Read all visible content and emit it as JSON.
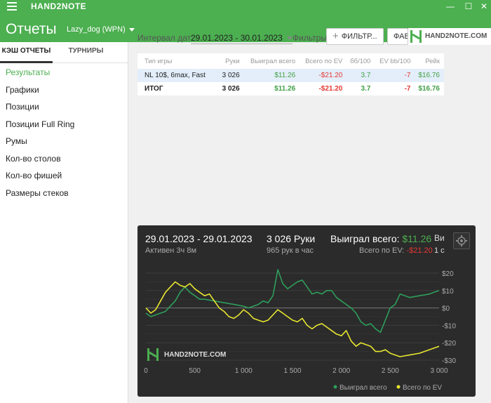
{
  "window": {
    "app_name": "HAND2NOTE",
    "minimize": "—",
    "maximize": "☐",
    "close": "✕"
  },
  "header": {
    "title": "Отчеты",
    "account": "Lazy_dog (WPN)"
  },
  "sidebar": {
    "tabs": [
      {
        "label": "КЭШ ОТЧЕТЫ"
      },
      {
        "label": "ТУРНИРЫ"
      }
    ],
    "items": [
      {
        "label": "Результаты"
      },
      {
        "label": "Графики"
      },
      {
        "label": "Позиции"
      },
      {
        "label": "Позиции Full Ring"
      },
      {
        "label": "Румы"
      },
      {
        "label": "Кол-во столов"
      },
      {
        "label": "Кол-во фишей"
      },
      {
        "label": "Размеры стеков"
      }
    ]
  },
  "filterbar": {
    "interval_label": "Интервал дат:",
    "date_range": "29.01.2023 - 30.01.2023",
    "filters_label": "Фильтры:",
    "filters_button": "ФИЛЬТР...",
    "fav_button": "ФАВ",
    "brand": "HAND2NOTE.COM"
  },
  "table": {
    "headers": [
      "Тип игры",
      "Руки",
      "Выиграл всего",
      "Всего по EV",
      "бб/100",
      "EV bb/100",
      "Рейк"
    ],
    "rows": [
      {
        "game": "NL 10$, 6max, Fast",
        "hands": "3 026",
        "won": "$11.26",
        "ev": "-$21.20",
        "bb100": "3.7",
        "evbb": "-7",
        "rake": "$16.76"
      }
    ],
    "total": {
      "game": "ИТОГ",
      "hands": "3 026",
      "won": "$11.26",
      "ev": "-$21.20",
      "bb100": "3.7",
      "evbb": "-7",
      "rake": "$16.76"
    }
  },
  "chart_panel": {
    "range": "29.01.2023 - 29.01.2023",
    "active": "Активен 3ч 8м",
    "hands": "3 026 Руки",
    "rate": "965 рук в час",
    "won_label": "Выиграл всего:",
    "won_value": "$11.26",
    "ev_label": "Всего по EV:",
    "ev_value": "-$21.20",
    "extra_top": "Ви",
    "extra_bottom": "1 с",
    "watermark": "HAND2NOTE.COM"
  },
  "chart_data": {
    "type": "line",
    "xlim": [
      0,
      3000
    ],
    "ylim": [
      -30,
      20
    ],
    "x_ticks": [
      "0",
      "500",
      "1 000",
      "1 500",
      "2 000",
      "2 500",
      "3 000"
    ],
    "y_ticks": [
      "$20",
      "$10",
      "$0",
      "-$10",
      "-$20",
      "-$30"
    ],
    "grid": true,
    "legend": "bottom-right",
    "colors": {
      "won": "#2e9e5b",
      "ev": "#e8e630"
    },
    "series": [
      {
        "name": "Выиграл всего",
        "color": "#2e9e5b",
        "x": [
          0,
          50,
          100,
          150,
          200,
          250,
          300,
          350,
          400,
          450,
          500,
          550,
          600,
          700,
          800,
          900,
          1000,
          1050,
          1100,
          1150,
          1200,
          1250,
          1300,
          1350,
          1400,
          1450,
          1500,
          1550,
          1600,
          1650,
          1700,
          1750,
          1800,
          1850,
          1900,
          1950,
          2000,
          2050,
          2100,
          2150,
          2200,
          2250,
          2300,
          2350,
          2400,
          2450,
          2500,
          2550,
          2600,
          2700,
          2800,
          2900,
          3000
        ],
        "y": [
          -3,
          -5,
          -4,
          -3,
          -2,
          1,
          4,
          9,
          12,
          9,
          7,
          5,
          5,
          4,
          3,
          2,
          1,
          0,
          1,
          2,
          4,
          3,
          7,
          22,
          14,
          11,
          13,
          15,
          16,
          12,
          8,
          9,
          8,
          10,
          10,
          6,
          4,
          2,
          0,
          -3,
          -8,
          -10,
          -9,
          -12,
          -14,
          -7,
          0,
          2,
          8,
          6,
          7,
          8,
          10
        ]
      },
      {
        "name": "Всего по EV",
        "color": "#e8e630",
        "x": [
          0,
          50,
          100,
          150,
          200,
          250,
          300,
          350,
          400,
          450,
          500,
          550,
          600,
          650,
          700,
          750,
          800,
          850,
          900,
          950,
          1000,
          1050,
          1100,
          1150,
          1200,
          1250,
          1300,
          1350,
          1400,
          1450,
          1500,
          1550,
          1600,
          1650,
          1700,
          1750,
          1800,
          1850,
          1900,
          1950,
          2000,
          2050,
          2100,
          2150,
          2200,
          2250,
          2300,
          2350,
          2400,
          2450,
          2500,
          2550,
          2600,
          2700,
          2800,
          2900,
          3000
        ],
        "y": [
          0,
          -3,
          -1,
          4,
          9,
          12,
          15,
          13,
          12,
          14,
          11,
          9,
          7,
          8,
          4,
          0,
          -2,
          -5,
          -6,
          -4,
          -1,
          -3,
          -6,
          -7,
          -8,
          -7,
          -4,
          -1,
          -3,
          -5,
          -7,
          -8,
          -6,
          -10,
          -12,
          -10,
          -9,
          -11,
          -13,
          -15,
          -16,
          -13,
          -19,
          -22,
          -20,
          -21,
          -22,
          -25,
          -25,
          -24,
          -26,
          -27,
          -28,
          -27,
          -26,
          -24,
          -22
        ]
      }
    ]
  }
}
